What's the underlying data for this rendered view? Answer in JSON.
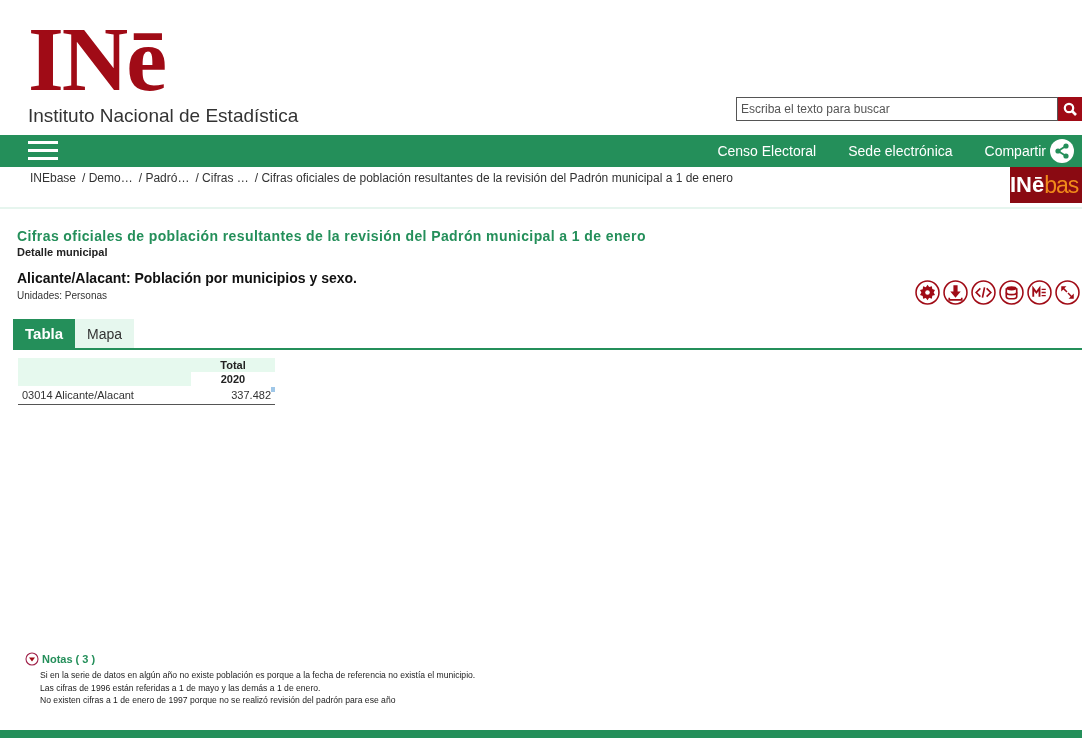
{
  "header": {
    "logo": "INē",
    "institute": "Instituto Nacional de Estadística",
    "search": {
      "placeholder": "Escriba el texto para buscar"
    }
  },
  "navbar": {
    "links": [
      "Censo Electoral",
      "Sede electrónica"
    ],
    "share": "Compartir"
  },
  "breadcrumb": [
    "INEbase",
    "/ Demo…",
    "/ Padró…",
    "/ Cifras …",
    "/ Cifras oficiales de población resultantes de la revisión del Padrón municipal a 1 de enero"
  ],
  "inebase_logo": {
    "prefix": "INē",
    "suffix": "bas"
  },
  "content": {
    "title": "Cifras oficiales de población resultantes de la revisión del Padrón municipal a 1 de enero",
    "subtitle": "Detalle municipal",
    "table_title": "Alicante/Alacant: Población por municipios y sexo.",
    "units": "Unidades:  Personas"
  },
  "tabs": [
    {
      "label": "Tabla",
      "selected": true
    },
    {
      "label": "Mapa",
      "selected": false
    }
  ],
  "table": {
    "columns": [
      {
        "label": "Total",
        "sub": "2020"
      }
    ],
    "rows": [
      {
        "label": "03014 Alicante/Alacant",
        "values": [
          "337.482"
        ]
      }
    ]
  },
  "notes": {
    "title": "Notas ( 3 )",
    "expanded": true,
    "items": [
      "Si en la serie de datos en algún año no existe población es porque a la fecha de referencia no existía el municipio.",
      "Las cifras de 1996 están referidas a 1 de mayo y las demás a 1 de enero.",
      "No existen cifras a 1 de enero de 1997 porque no se realizó revisión del padrón para ese año"
    ]
  }
}
